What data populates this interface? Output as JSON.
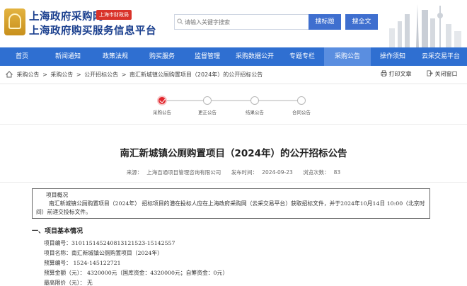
{
  "header": {
    "title_line1": "上海政府采购网",
    "badge": "上海市财政局",
    "title_line2": "上海政府购买服务信息平台",
    "search_placeholder": "请输入关键字搜索",
    "search_title_button": "搜标题",
    "search_all_button": "搜全文"
  },
  "nav": {
    "items": [
      "首页",
      "新闻通知",
      "政策法规",
      "购买服务",
      "监督管理",
      "采购数据公开",
      "专题专栏",
      "采购公告",
      "操作须知",
      "云采交易平台"
    ],
    "active_index": 7
  },
  "breadcrumb": {
    "items": [
      "采购公告",
      "采购公告",
      "公开招标公告",
      "南汇新城镇公厕购置项目（2024年）的公开招标公告"
    ],
    "separator": ">",
    "print_label": "打印文章",
    "close_label": "关闭窗口"
  },
  "steps": {
    "items": [
      "采购公告",
      "更正公告",
      "结果公告",
      "合同公告"
    ],
    "active_index": 0
  },
  "article": {
    "title": "南汇新城镇公厕购置项目（2024年）的公开招标公告",
    "source_label": "来源：",
    "source": "上海百通项目管理咨询有限公司",
    "date_label": "发布时间：",
    "date": "2024-09-23",
    "views_label": "浏览次数：",
    "views": "83"
  },
  "overview": {
    "heading": "项目概况",
    "body": "南汇新城镇公厕购置项目（2024年） 招标项目的潜在投标人应在上海政府采购网（云采交易平台）获取招标文件，并于2024年10月14日 10:00（北京时间）前递交投标文件。"
  },
  "section": {
    "heading": "一、项目基本情况",
    "lines": [
      "项目编号：310115145240813121523-15142557",
      "项目名称：南汇新城镇公厕购置项目（2024年）",
      "预算编号： 1524-145122721",
      "预算金额（元）： 4320000元（国库资金：4320000元；自筹资金：0元）",
      "最高限价（元）： 无"
    ]
  },
  "colors": {
    "nav_bg": "#2f6fd1",
    "nav_active": "#5a8ee0",
    "title_blue": "#1a3f8e",
    "step_active": "#e2252c",
    "button_blue": "#3f6fcf"
  }
}
